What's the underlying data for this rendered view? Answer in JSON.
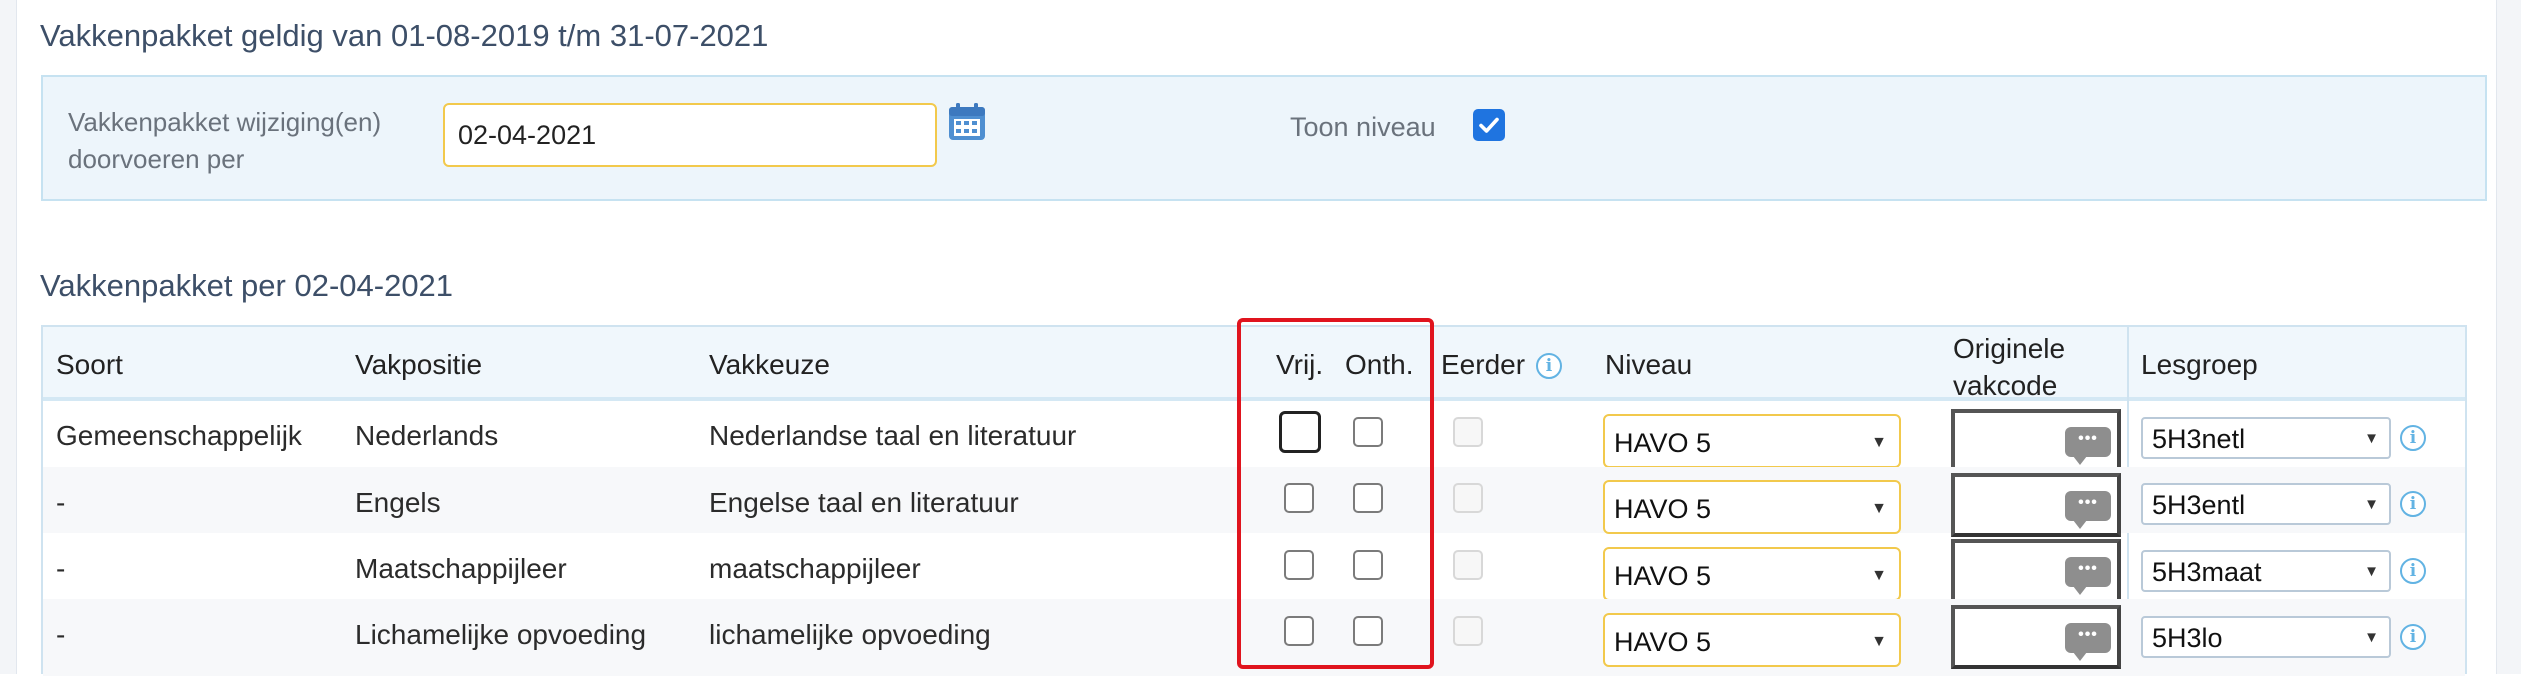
{
  "header": {
    "title": "Vakkenpakket geldig van 01-08-2019 t/m 31-07-2021"
  },
  "change_panel": {
    "label_line1": "Vakkenpakket wijziging(en)",
    "label_line2": "doorvoeren per",
    "date_value": "02-04-2021",
    "toon_niveau_label": "Toon niveau",
    "toon_niveau_checked": true
  },
  "section": {
    "title": "Vakkenpakket per 02-04-2021"
  },
  "table": {
    "headers": {
      "soort": "Soort",
      "vakpositie": "Vakpositie",
      "vakkeuze": "Vakkeuze",
      "vrij": "Vrij.",
      "onth": "Onth.",
      "eerder": "Eerder",
      "niveau": "Niveau",
      "originele_line1": "Originele",
      "originele_line2": "vakcode",
      "lesgroep": "Lesgroep"
    },
    "rows": [
      {
        "soort": "Gemeenschappelijk",
        "vakpositie": "Nederlands",
        "vakkeuze": "Nederlandse taal en literatuur",
        "niveau": "HAVO 5",
        "lesgroep": "5H3netl"
      },
      {
        "soort": "-",
        "vakpositie": "Engels",
        "vakkeuze": "Engelse taal en literatuur",
        "niveau": "HAVO 5",
        "lesgroep": "5H3entl"
      },
      {
        "soort": "-",
        "vakpositie": "Maatschappijleer",
        "vakkeuze": "maatschappijleer",
        "niveau": "HAVO 5",
        "lesgroep": "5H3maat"
      },
      {
        "soort": "-",
        "vakpositie": "Lichamelijke opvoeding",
        "vakkeuze": "lichamelijke opvoeding",
        "niveau": "HAVO 5",
        "lesgroep": "5H3lo"
      }
    ]
  },
  "glyphs": {
    "dropdown_arrow": "▼",
    "comment_dots": "•••",
    "info": "i"
  },
  "colors": {
    "accent_blue": "#1f74e0",
    "info_blue": "#62b3e3",
    "input_border_yellow": "#f2c94c",
    "highlight_red": "#e0141e"
  }
}
